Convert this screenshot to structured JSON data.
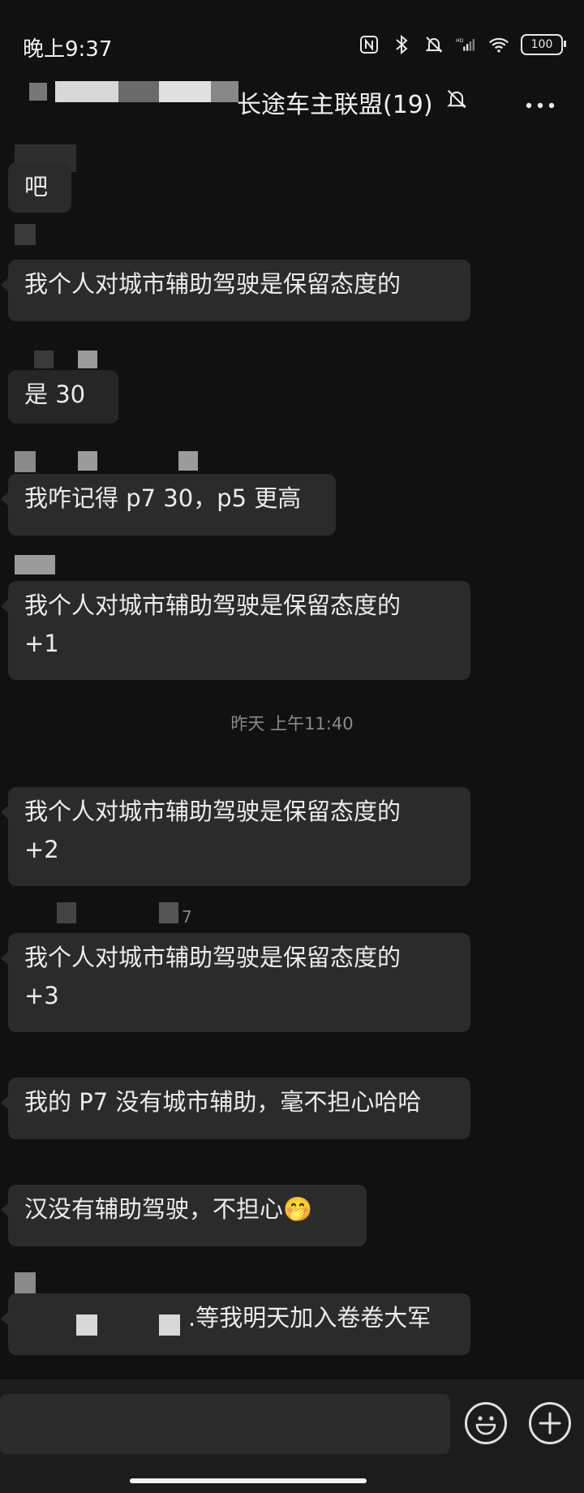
{
  "status_bar": {
    "time": "晚上9:37",
    "battery": "100",
    "icons": [
      "nfc-icon",
      "bluetooth-icon",
      "bell-off-icon",
      "hd-signal-icon",
      "wifi-icon",
      "battery-icon"
    ]
  },
  "header": {
    "title": "长途车主联盟(19)",
    "icons": [
      "bell-off-icon",
      "more-icon"
    ]
  },
  "messages": [
    {
      "lines": [
        "吧"
      ]
    },
    {
      "lines": [
        "我个人对城市辅助驾驶是保留态度的"
      ]
    },
    {
      "lines": [
        "是 30"
      ]
    },
    {
      "lines": [
        "我咋记得 p7 30，p5 更高"
      ]
    },
    {
      "lines": [
        "我个人对城市辅助驾驶是保留态度的",
        "+1"
      ]
    },
    {
      "lines": [
        "我个人对城市辅助驾驶是保留态度的",
        "+2"
      ]
    },
    {
      "lines": [
        "我个人对城市辅助驾驶是保留态度的",
        "+3"
      ]
    },
    {
      "lines": [
        "我的 P7 没有城市辅助，毫不担心哈哈"
      ]
    },
    {
      "lines": [
        "汉没有辅助驾驶，不担心🤭"
      ]
    },
    {
      "lines": [
        ".等我明天加入卷卷大军"
      ]
    }
  ],
  "timestamp": "昨天 上午11:40",
  "sender_fragment": "7",
  "input_bar": {
    "icons": [
      "emoji-icon",
      "plus-icon"
    ]
  }
}
